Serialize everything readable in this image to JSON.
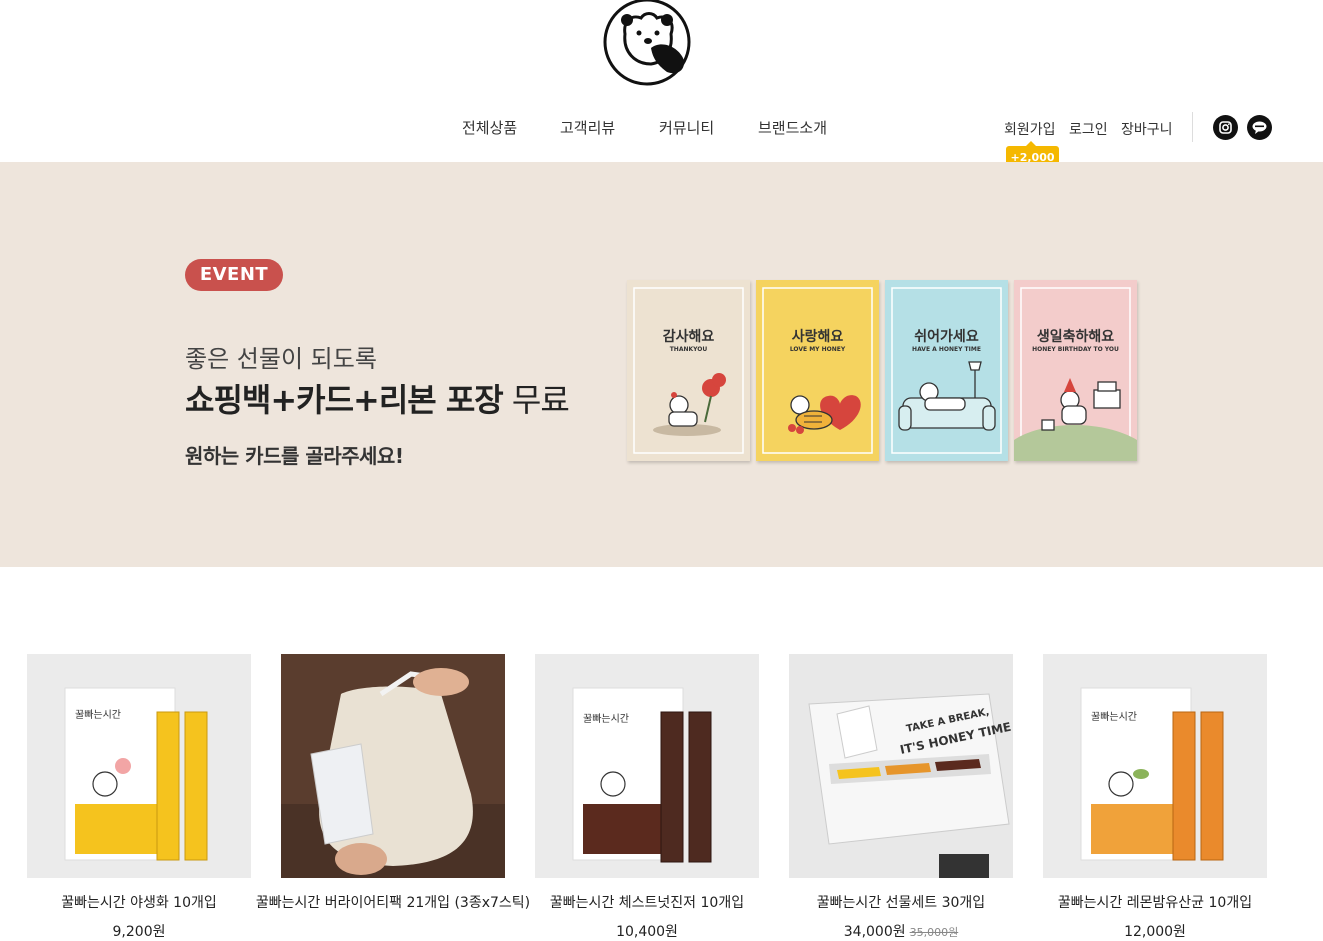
{
  "header": {
    "logo": "bear-logo",
    "nav": [
      "전체상품",
      "고객리뷰",
      "커뮤니티",
      "브랜드소개"
    ],
    "util": {
      "signup": "회원가입",
      "login": "로그인",
      "cart": "장바구니",
      "signup_badge": "+2,000"
    },
    "sns": [
      "instagram-icon",
      "kakao-talk-icon"
    ]
  },
  "banner": {
    "event_label": "EVENT",
    "line1": "좋은 선물이 되도록",
    "line2_bold": "쇼핑백+카드+리본 포장",
    "line2_rest": " 무료",
    "line3": "원하는 카드를 골라주세요!",
    "cards": [
      {
        "title": "감사해요",
        "subtitle": "THANKYOU",
        "color": "#ede2d1"
      },
      {
        "title": "사랑해요",
        "subtitle": "LOVE MY HONEY",
        "color": "#f5d35f"
      },
      {
        "title": "쉬어가세요",
        "subtitle": "HAVE A HONEY TIME",
        "color": "#b5e0e6"
      },
      {
        "title": "생일축하해요",
        "subtitle": "HONEY BIRTHDAY TO YOU",
        "color": "#f3cccb"
      }
    ]
  },
  "products": [
    {
      "name": "꿀빠는시간 야생화 10개입",
      "price": "9,200원",
      "original": ""
    },
    {
      "name": "꿀빠는시간 버라이어티팩 21개입 (3종x7스틱)",
      "price": "",
      "original": ""
    },
    {
      "name": "꿀빠는시간 체스트넛진저 10개입",
      "price": "10,400원",
      "original": ""
    },
    {
      "name": "꿀빠는시간 선물세트 30개입",
      "price": "34,000원",
      "original": "35,000원"
    },
    {
      "name": "꿀빠는시간 레몬밤유산균 10개입",
      "price": "12,000원",
      "original": ""
    }
  ],
  "product_images": {
    "p1_box_brand": "꿀빠는시간",
    "p3_box_brand": "꿀빠는시간",
    "p5_box_brand": "꿀빠는시간",
    "p4_box_line1": "TAKE A BREAK,",
    "p4_box_line2": "IT'S HONEY TIME"
  }
}
